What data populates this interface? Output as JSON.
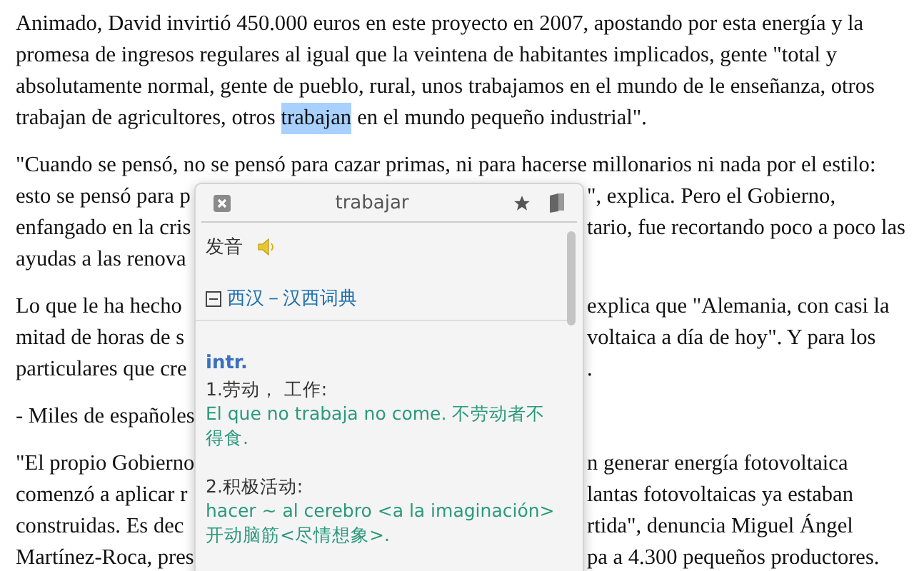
{
  "article": {
    "paragraphs": [
      {
        "lines": [
          {
            "kind": "full",
            "text": "Animado, David invirtió 450.000 euros en este proyecto en 2007, apostando por esta energía y la"
          },
          {
            "kind": "full",
            "text": "promesa de ingresos regulares al igual que la veintena de habitantes implicados, gente \"total y"
          },
          {
            "kind": "full",
            "text": "absolutamente normal, gente de pueblo, rural, unos trabajamos en el mundo de le enseñanza, otros"
          },
          {
            "kind": "highlighted",
            "segments": [
              {
                "text": "trabajan de agricultores, otros",
                "selected": false
              },
              {
                "text": "trabajan",
                "selected": true
              },
              {
                "text": "en el mundo pequeño industrial\".",
                "selected": false
              }
            ]
          }
        ]
      },
      {
        "lines": [
          {
            "kind": "full",
            "text": "\"Cuando se pensó, no se pensó para cazar primas, ni para hacerse millonarios ni nada por el estilo:"
          },
          {
            "kind": "split",
            "left": "esto se pensó para p",
            "right": "\", explica. Pero el Gobierno,"
          },
          {
            "kind": "split",
            "left": "enfangado en la cris",
            "right": "tario, fue recortando poco a poco las"
          },
          {
            "kind": "split",
            "left": "ayudas a las renova"
          }
        ]
      },
      {
        "lines": [
          {
            "kind": "split",
            "left": "Lo que le ha hecho",
            "right": "explica que \"Alemania, con casi la"
          },
          {
            "kind": "split",
            "left": "mitad de horas de s",
            "right": "voltaica a día de hoy\". Y para los"
          },
          {
            "kind": "split",
            "left": "particulares que cre",
            "right": "."
          }
        ]
      },
      {
        "lines": [
          {
            "kind": "split",
            "left": "- Miles de españoles"
          }
        ]
      },
      {
        "lines": [
          {
            "kind": "split",
            "left": "\"El propio Gobierno",
            "right": "n generar energía fotovoltaica"
          },
          {
            "kind": "split",
            "left": "comenzó a aplicar r",
            "right": "lantas fotovoltaicas ya estaban"
          },
          {
            "kind": "split",
            "left": "construidas. Es dec",
            "right": "rtida\", denuncia Miguel Ángel"
          },
          {
            "kind": "split",
            "left": "Martínez-Roca, pres",
            "right": "pa a 4.300 pequeños productores."
          }
        ]
      }
    ]
  },
  "dictionary_popup": {
    "title": "trabajar",
    "pronunciation_label": "发音",
    "dictionary": {
      "name": "西汉－汉西词典",
      "expanded": true
    },
    "part_of_speech": "intr.",
    "senses": [
      {
        "label": "1.劳动， 工作:",
        "example": "El que no trabaja no come. 不劳动者不得食."
      },
      {
        "label": "2.积极活动:",
        "example": "hacer ~ al cerebro <a la imaginación> 开动脑筋<尽情想象>."
      }
    ]
  }
}
